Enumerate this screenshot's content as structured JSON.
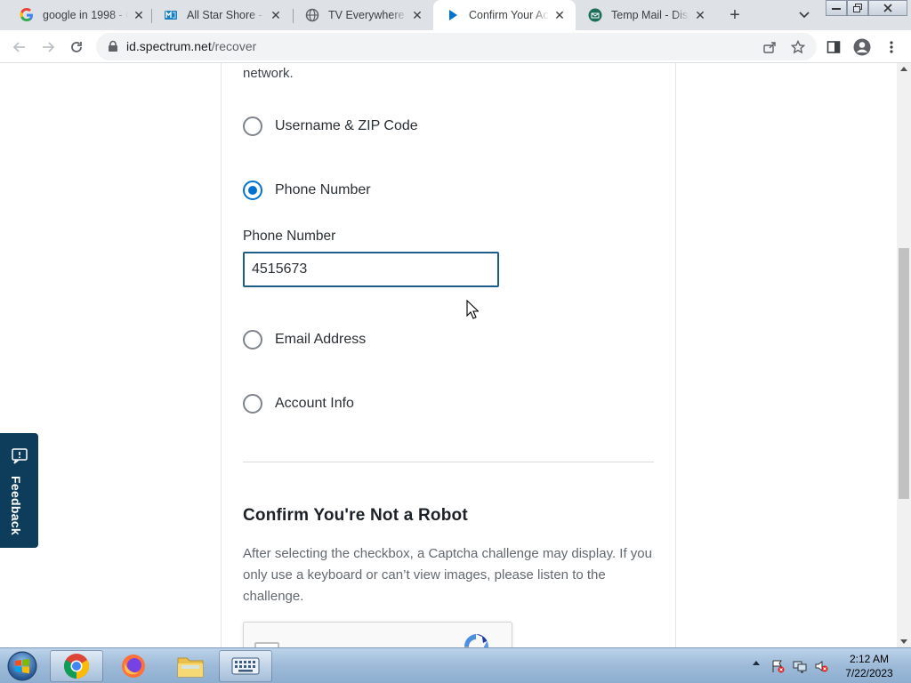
{
  "browser": {
    "tabs": [
      {
        "title": "google in 1998 - Go",
        "favicon": "google-icon",
        "active": false
      },
      {
        "title": "All Star Shore - Se",
        "favicon": "allstar-icon",
        "active": false
      },
      {
        "title": "TV Everywhere",
        "favicon": "globe-icon",
        "active": false
      },
      {
        "title": "Confirm Your Acco",
        "favicon": "spectrum-play-icon",
        "active": true
      },
      {
        "title": "Temp Mail - Dispo",
        "favicon": "tempmail-icon",
        "active": false
      }
    ],
    "url_host": "id.spectrum.net",
    "url_path": "/recover"
  },
  "page": {
    "intro_text": "network.",
    "options": [
      {
        "label": "Username & ZIP Code",
        "checked": false
      },
      {
        "label": "Phone Number",
        "checked": true
      },
      {
        "label": "Email Address",
        "checked": false
      },
      {
        "label": "Account Info",
        "checked": false
      }
    ],
    "phone_field": {
      "label": "Phone Number",
      "value": "4515673"
    },
    "robot_section": {
      "title": "Confirm You're Not a Robot",
      "description": "After selecting the checkbox, a Captcha challenge may display. If you only use a keyboard or can’t view images, please listen to the challenge."
    },
    "feedback_label": "Feedback"
  },
  "taskbar": {
    "clock_time": "2:12 AM",
    "clock_date": "7/22/2023"
  },
  "colors": {
    "accent": "#0073d1",
    "feedback_bg": "#0e3d5c",
    "input_border": "#1c5d8a"
  }
}
